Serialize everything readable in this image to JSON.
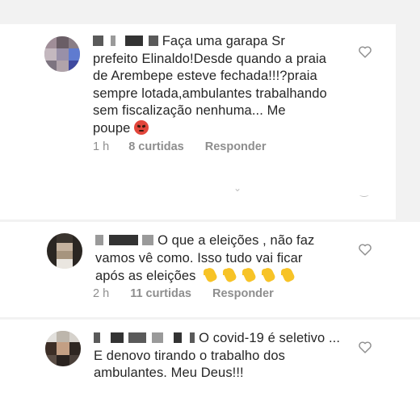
{
  "comments": [
    {
      "text_lines": [
        "Faça uma garapa Sr",
        "prefeito Elinaldo!Desde quando a praia",
        "de Arembepe esteve fechada!!!?praia",
        "sempre lotada,ambulantes trabalhando",
        "sem fiscalização nenhuma... Me",
        "poupe"
      ],
      "time": "1 h",
      "likes": "8 curtidas",
      "reply": "Responder",
      "emoji": "angry-face-icon"
    },
    {
      "text_lines": [
        "O que a eleições , não faz",
        "vamos vê como. Isso tudo vai ficar",
        "após as eleições"
      ],
      "time": "2 h",
      "likes": "11 curtidas",
      "reply": "Responder",
      "emoji": "clapping-hands-icon",
      "emoji_count": 5
    },
    {
      "text_lines": [
        "O covid-19 é seletivo ...",
        "E denovo tirando o trabalho dos",
        "ambulantes. Meu Deus!!!"
      ]
    }
  ],
  "colors": {
    "text": "#262626",
    "meta": "#8e8e8e",
    "background": "#f2f2f2",
    "card": "#ffffff"
  }
}
